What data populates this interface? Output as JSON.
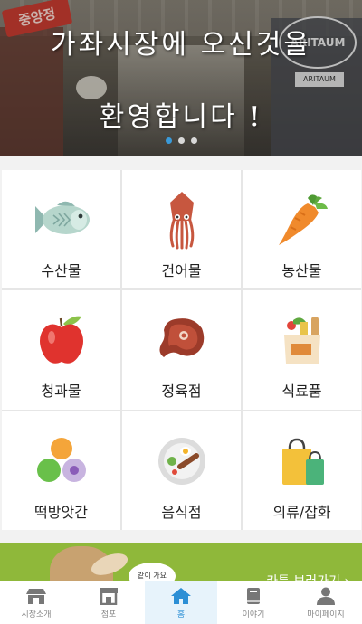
{
  "banner": {
    "line1": "가좌시장에 오신것을",
    "line2": "환영합니다 !",
    "signs": {
      "left_sign": "중앙정",
      "right_sign": "ARITAUM",
      "right_sign_small": "ARITAUM"
    },
    "slides": 3,
    "active_slide": 0
  },
  "categories": [
    {
      "label": "수산물",
      "icon": "fish-icon"
    },
    {
      "label": "건어물",
      "icon": "squid-icon"
    },
    {
      "label": "농산물",
      "icon": "carrot-icon"
    },
    {
      "label": "청과물",
      "icon": "apple-icon"
    },
    {
      "label": "정육점",
      "icon": "steak-icon"
    },
    {
      "label": "식료품",
      "icon": "grocery-bag-icon"
    },
    {
      "label": "떡방앗간",
      "icon": "rice-cake-icon"
    },
    {
      "label": "음식점",
      "icon": "food-plate-icon"
    },
    {
      "label": "의류/잡화",
      "icon": "shopping-bags-icon"
    }
  ],
  "promo": {
    "text": "카툰 보러가기 ›",
    "bubble_text": "같이 가요"
  },
  "bottom_nav": [
    {
      "label": "시장소개",
      "icon": "market-icon",
      "active": false
    },
    {
      "label": "점포",
      "icon": "store-icon",
      "active": false
    },
    {
      "label": "홈",
      "icon": "home-icon",
      "active": true
    },
    {
      "label": "이야기",
      "icon": "book-icon",
      "active": false
    },
    {
      "label": "마이페이지",
      "icon": "person-icon",
      "active": false
    }
  ],
  "colors": {
    "accent": "#2d8fd5",
    "active_tab_bg": "#e7f3fb",
    "promo_green": "#8fb83a",
    "grid_line": "#e6e6e6"
  }
}
